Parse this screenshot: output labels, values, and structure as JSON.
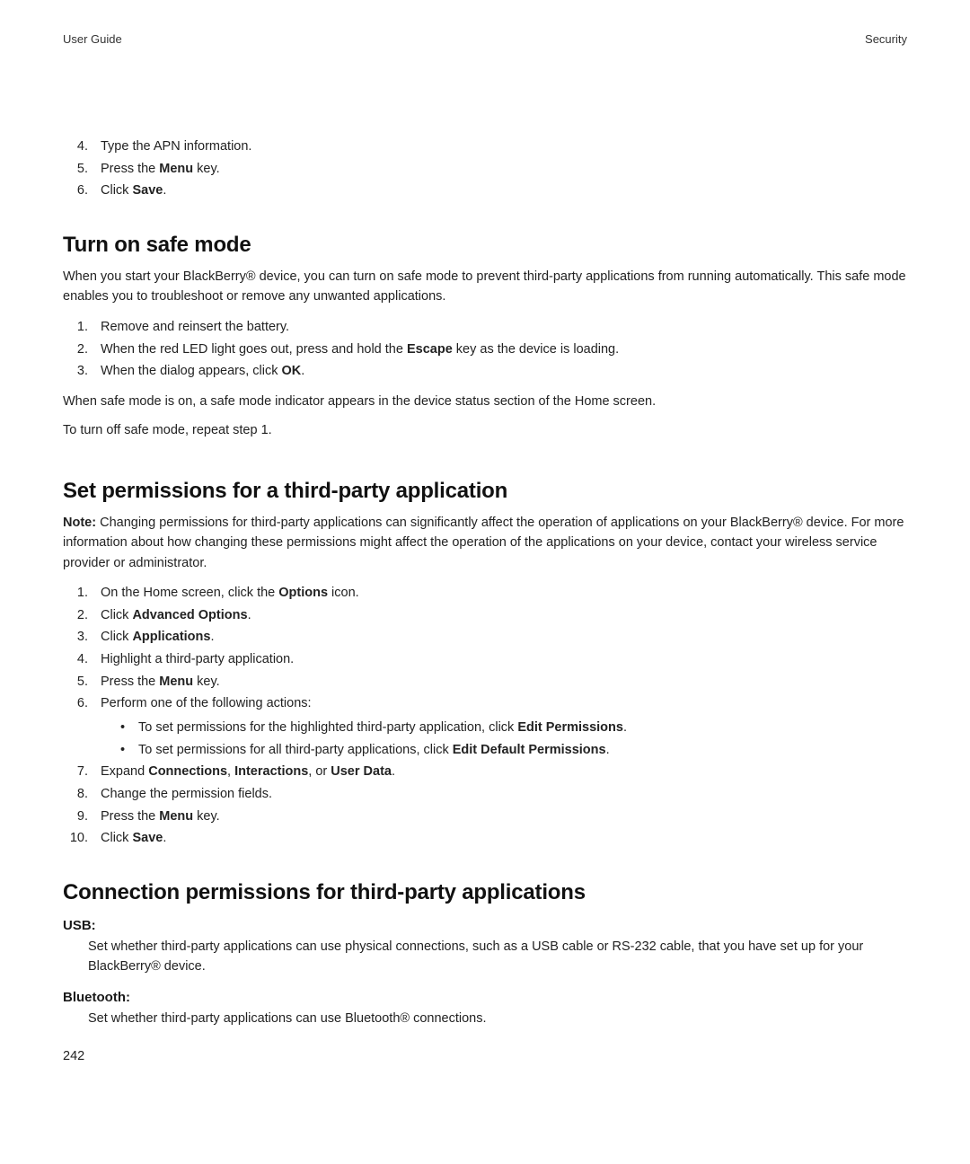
{
  "header": {
    "left": "User Guide",
    "right": "Security"
  },
  "top_steps": [
    {
      "n": "4.",
      "text": "Type the APN information."
    },
    {
      "n": "5.",
      "pre": "Press the ",
      "bold": "Menu",
      "post": " key."
    },
    {
      "n": "6.",
      "pre": "Click ",
      "bold": "Save",
      "post": "."
    }
  ],
  "safe_mode": {
    "title": "Turn on safe mode",
    "intro": "When you start your BlackBerry® device, you can turn on safe mode to prevent third-party applications from running automatically. This safe mode enables you to troubleshoot or remove any unwanted applications.",
    "steps": [
      {
        "n": "1.",
        "text": "Remove and reinsert the battery."
      },
      {
        "n": "2.",
        "pre": "When the red LED light goes out, press and hold the ",
        "bold": "Escape",
        "post": " key as the device is loading."
      },
      {
        "n": "3.",
        "pre": "When the dialog appears, click ",
        "bold": "OK",
        "post": "."
      }
    ],
    "para_a": "When safe mode is on, a safe mode indicator appears in the device status section of the Home screen.",
    "para_b": "To turn off safe mode, repeat step 1."
  },
  "perms": {
    "title": "Set permissions for a third-party application",
    "note_label": "Note:",
    "note_body": "  Changing permissions for third-party applications can significantly affect the operation of applications on your BlackBerry® device. For more information about how changing these permissions might affect the operation of the applications on your device, contact your wireless service provider or administrator.",
    "steps": {
      "s1": {
        "n": "1.",
        "pre": "On the Home screen, click the ",
        "bold": "Options",
        "post": " icon."
      },
      "s2": {
        "n": "2.",
        "pre": "Click ",
        "bold": "Advanced Options",
        "post": "."
      },
      "s3": {
        "n": "3.",
        "pre": "Click ",
        "bold": "Applications",
        "post": "."
      },
      "s4": {
        "n": "4.",
        "text": "Highlight a third-party application."
      },
      "s5": {
        "n": "5.",
        "pre": "Press the ",
        "bold": "Menu",
        "post": " key."
      },
      "s6": {
        "n": "6.",
        "text": "Perform one of the following actions:"
      },
      "s6a": {
        "pre": "To set permissions for the highlighted third-party application, click ",
        "bold": "Edit Permissions",
        "post": "."
      },
      "s6b": {
        "pre": "To set permissions for all third-party applications, click ",
        "bold": "Edit Default Permissions",
        "post": "."
      },
      "s7": {
        "n": "7.",
        "pre": "Expand ",
        "b1": "Connections",
        "sep1": ", ",
        "b2": "Interactions",
        "sep2": ", or ",
        "b3": "User Data",
        "post": "."
      },
      "s8": {
        "n": "8.",
        "text": "Change the permission fields."
      },
      "s9": {
        "n": "9.",
        "pre": "Press the ",
        "bold": "Menu",
        "post": " key."
      },
      "s10": {
        "n": "10.",
        "pre": "Click ",
        "bold": "Save",
        "post": "."
      }
    }
  },
  "conn": {
    "title": "Connection permissions for third-party applications",
    "usb_term": "USB:",
    "usb_desc": "Set whether third-party applications can use physical connections, such as a USB cable or RS-232 cable, that you have set up for your BlackBerry® device.",
    "bt_term": "Bluetooth:",
    "bt_desc": "Set whether third-party applications can use Bluetooth® connections."
  },
  "page_number": "242"
}
